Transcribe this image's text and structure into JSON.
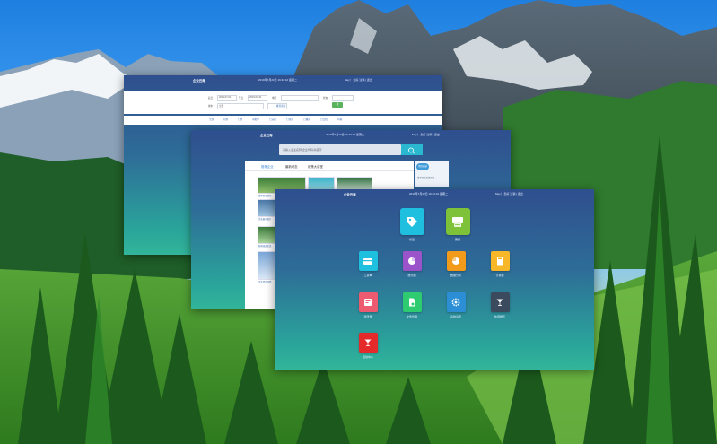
{
  "windows": {
    "back": {
      "title": "企业云海",
      "time": "2019年7月20日 16:40:10 星期二",
      "user": "Mey！ 您好   注销 | 退出",
      "form": {
        "labels": [
          "起日",
          "至日",
          "地区",
          "状态",
          "城市"
        ],
        "values": [
          "2019-07-01",
          "2019-07-31",
          "全部",
          "全部"
        ],
        "tag": "推荐商家",
        "search_button": "搜"
      },
      "tabs": [
        "全部",
        "待办",
        "已办",
        "审批中",
        "已完成",
        "已驳回",
        "已撤销",
        "已归档",
        "草稿"
      ]
    },
    "middle": {
      "title": "企业云海",
      "time": "2019年7月20日 16:40:10 星期二",
      "user": "Mey！ 您好   注销 | 退出",
      "search_placeholder": "请输入企业名称/企业代码/关键字",
      "tabs": [
        "推荐企业",
        "最新动态",
        "政策大讲堂"
      ],
      "captions": [
        "推荐企业资讯",
        "企业展示图片",
        "新闻动态信息",
        "企业资讯详情"
      ],
      "aside_badge": "我的商城",
      "aside_note": "推荐企业优惠活动"
    },
    "front": {
      "title": "企业云海",
      "time": "2019年7月20日 16:40:10 星期二",
      "user": "Mey！ 您好   注销 | 退出",
      "apps": [
        {
          "label": "标签",
          "icon": "tag-icon",
          "color": "#1fbfe0"
        },
        {
          "label": "票据",
          "icon": "printer-icon",
          "color": "#7ec23a"
        },
        {
          "label": "工资单",
          "icon": "card-icon",
          "color": "#1fbfe0"
        },
        {
          "label": "统计图",
          "icon": "pie-chart-icon",
          "color": "#9b53c9"
        },
        {
          "label": "数据分析",
          "icon": "pie-chart-icon",
          "color": "#f29a1a"
        },
        {
          "label": "计算器",
          "icon": "calculator-icon",
          "color": "#f7b728"
        },
        {
          "label": "通讯录",
          "icon": "contact-card-icon",
          "color": "#ee5a6f"
        },
        {
          "label": "文件管理",
          "icon": "document-icon",
          "color": "#2ecb70"
        },
        {
          "label": "系统设置",
          "icon": "gear-icon",
          "color": "#2c8fd6"
        },
        {
          "label": "休闲娱乐",
          "icon": "cocktail-icon",
          "color": "#3c4a5e"
        },
        {
          "label": "活动中心",
          "icon": "cocktail-icon",
          "color": "#e42a2a"
        }
      ]
    }
  }
}
